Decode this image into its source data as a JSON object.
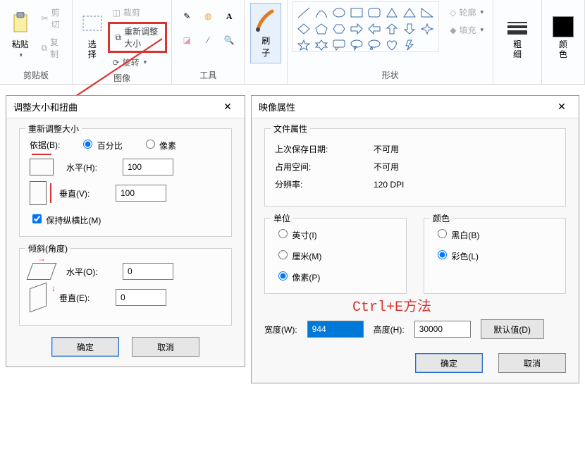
{
  "ribbon": {
    "clipboard": {
      "label": "剪贴板",
      "paste": "粘贴",
      "cut": "剪切",
      "copy": "复制"
    },
    "image": {
      "label": "图像",
      "select": "选\n择",
      "crop": "裁剪",
      "resize": "重新调整大小",
      "rotate": "旋转"
    },
    "tools": {
      "label": "工具"
    },
    "brushes": {
      "label": "刷\n子"
    },
    "shapes": {
      "label": "形状",
      "outline": "轮廓",
      "fill": "填充"
    },
    "thickness": {
      "label": "粗\n细"
    },
    "color": {
      "label": "颜\n色"
    }
  },
  "resize_dialog": {
    "title": "调整大小和扭曲",
    "resize_legend": "重新调整大小",
    "basis_label": "依据(B):",
    "percent": "百分比",
    "pixels": "像素",
    "horiz": "水平(H):",
    "vert": "垂直(V):",
    "h_value": "100",
    "v_value": "100",
    "aspect": "保持纵横比(M)",
    "skew_legend": "倾斜(角度)",
    "skew_h": "水平(O):",
    "skew_v": "垂直(E):",
    "skew_h_val": "0",
    "skew_v_val": "0",
    "ok": "确定",
    "cancel": "取消"
  },
  "props_dialog": {
    "title": "映像属性",
    "file_legend": "文件属性",
    "last_saved_label": "上次保存日期:",
    "last_saved_value": "不可用",
    "disk_label": "占用空间:",
    "disk_value": "不可用",
    "res_label": "分辨率:",
    "res_value": "120 DPI",
    "units_legend": "单位",
    "inches": "英寸(I)",
    "cm": "厘米(M)",
    "px": "像素(P)",
    "color_legend": "颜色",
    "bw": "黑白(B)",
    "color": "彩色(L)",
    "width_label": "宽度(W):",
    "width_value": "944",
    "height_label": "高度(H):",
    "height_value": "30000",
    "default_btn": "默认值(D)",
    "ok": "确定",
    "cancel": "取消"
  },
  "annotation": "Ctrl+E方法"
}
